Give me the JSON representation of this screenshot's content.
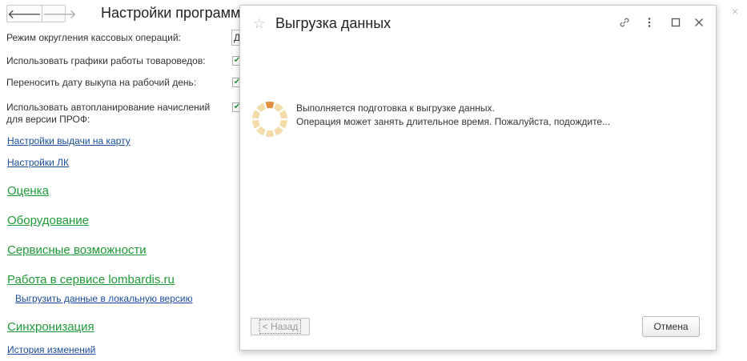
{
  "background": {
    "title": "Настройки программ",
    "close_glyph": "×",
    "rows": [
      {
        "label": "Режим округления кассовых операций:",
        "field_value": "Д"
      },
      {
        "label": "Использовать графики работы товароведов:",
        "checked": true
      },
      {
        "label": "Переносить дату выкупа на рабочий день:",
        "checked": true
      },
      {
        "label_line1": "Использовать автопланирование начислений",
        "label_line2": "для версии ПРОФ:",
        "checked": true
      }
    ],
    "links": {
      "card_payout": "Настройки выдачи на карту",
      "lk": "Настройки ЛК",
      "export_local": "Выгрузить данные в локальную версию",
      "history": "История изменений"
    },
    "sections": {
      "valuation": "Оценка",
      "equipment": "Оборудование",
      "service": "Сервисные возможности",
      "lombardis": "Работа в сервисе lombardis.ru",
      "sync": "Синхронизация"
    }
  },
  "dialog": {
    "title": "Выгрузка данных",
    "message_line1": "Выполняется подготовка к выгрузке данных.",
    "message_line2": "Операция может занять длительное время. Пожалуйста, подождите...",
    "back_button": "< Назад",
    "cancel_button": "Отмена"
  },
  "colors": {
    "section_green": "#1e9a37",
    "link_blue": "#1a4ea0",
    "spinner_active": "#e0903c",
    "spinner_idle": "#f3dcaa"
  },
  "icons": {
    "back": "arrow-left",
    "forward": "arrow-right",
    "favorite": "star",
    "link": "chain-link",
    "more": "vertical-dots",
    "maximize": "square",
    "close": "x"
  }
}
